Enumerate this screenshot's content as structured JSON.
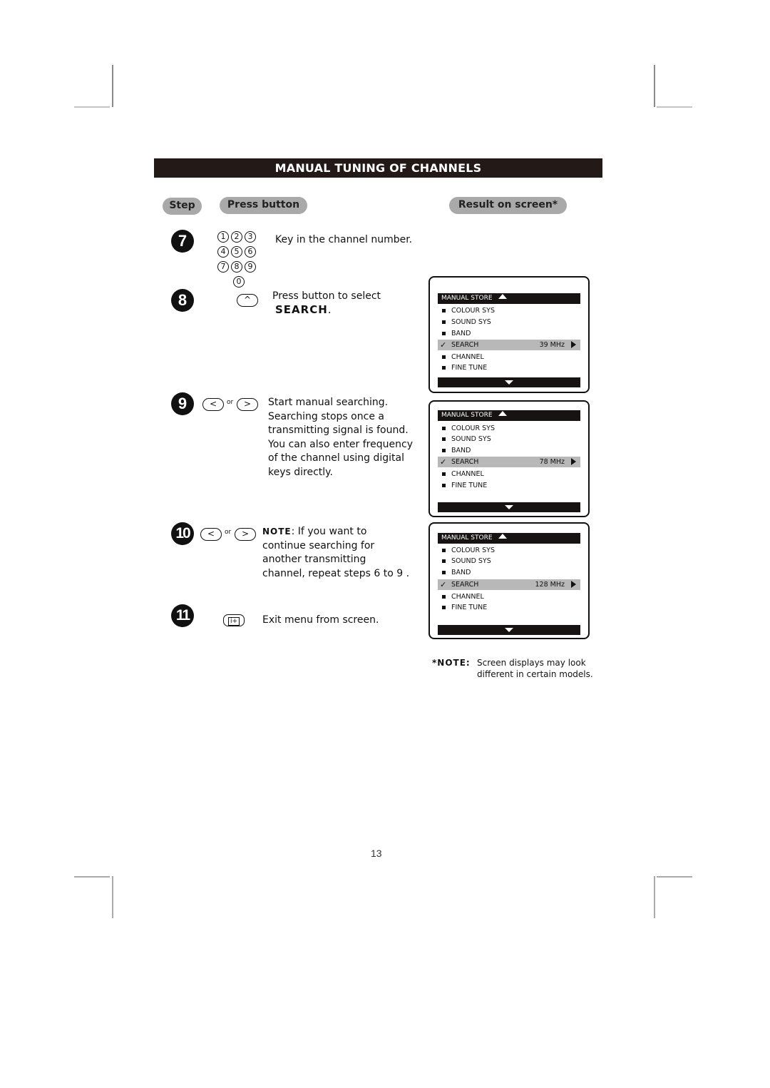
{
  "page": {
    "title": "MANUAL TUNING OF CHANNELS",
    "page_number": "13"
  },
  "columns": {
    "step": "Step",
    "press_button": "Press button",
    "result_on_screen": "Result on screen*"
  },
  "steps": [
    {
      "number": "7",
      "button": "numeric-keypad",
      "keys": [
        "1",
        "2",
        "3",
        "4",
        "5",
        "6",
        "7",
        "8",
        "9",
        "0"
      ],
      "text_lines": [
        "Key in the channel number."
      ]
    },
    {
      "number": "8",
      "button": "up-button",
      "button_glyph": "^",
      "text_lines": [
        "Press button to select"
      ],
      "emphasis": "SEARCH",
      "emphasis_suffix": "."
    },
    {
      "number": "9",
      "button": "left-or-right-button",
      "left_glyph": "<",
      "right_glyph": ">",
      "or_label": "or",
      "text_lines": [
        "Start manual searching.",
        "Searching stops once a",
        "transmitting signal is found.",
        "You can also enter frequency",
        "of the channel using digital",
        "keys directly."
      ]
    },
    {
      "number": "10",
      "button": "left-or-right-button",
      "left_glyph": "<",
      "right_glyph": ">",
      "or_label": "or",
      "note_label": "NOTE",
      "text_lines": [
        ": If you want to",
        "continue searching for",
        "another transmitting",
        "channel, repeat steps 6 to 9 ."
      ]
    },
    {
      "number": "11",
      "button": "info-button",
      "button_glyph": "i+",
      "text_lines": [
        "Exit menu from screen."
      ]
    }
  ],
  "screens": [
    {
      "header": "MANUAL STORE",
      "items": [
        "COLOUR  SYS",
        "SOUND  SYS",
        "BAND",
        "SEARCH",
        "CHANNEL",
        "FINE TUNE"
      ],
      "selected": "SEARCH",
      "frequency": "39 MHz"
    },
    {
      "header": "MANUAL STORE",
      "items": [
        "COLOUR  SYS",
        "SOUND  SYS",
        "BAND",
        "SEARCH",
        "CHANNEL",
        "FINE TUNE"
      ],
      "selected": "SEARCH",
      "frequency": "78 MHz"
    },
    {
      "header": "MANUAL STORE",
      "items": [
        "COLOUR  SYS",
        "SOUND  SYS",
        "BAND",
        "SEARCH",
        "CHANNEL",
        "FINE TUNE"
      ],
      "selected": "SEARCH",
      "frequency": "128 MHz"
    }
  ],
  "footnote": {
    "label": "*NOTE:",
    "lines": [
      "Screen displays may look",
      "different in certain models."
    ]
  }
}
